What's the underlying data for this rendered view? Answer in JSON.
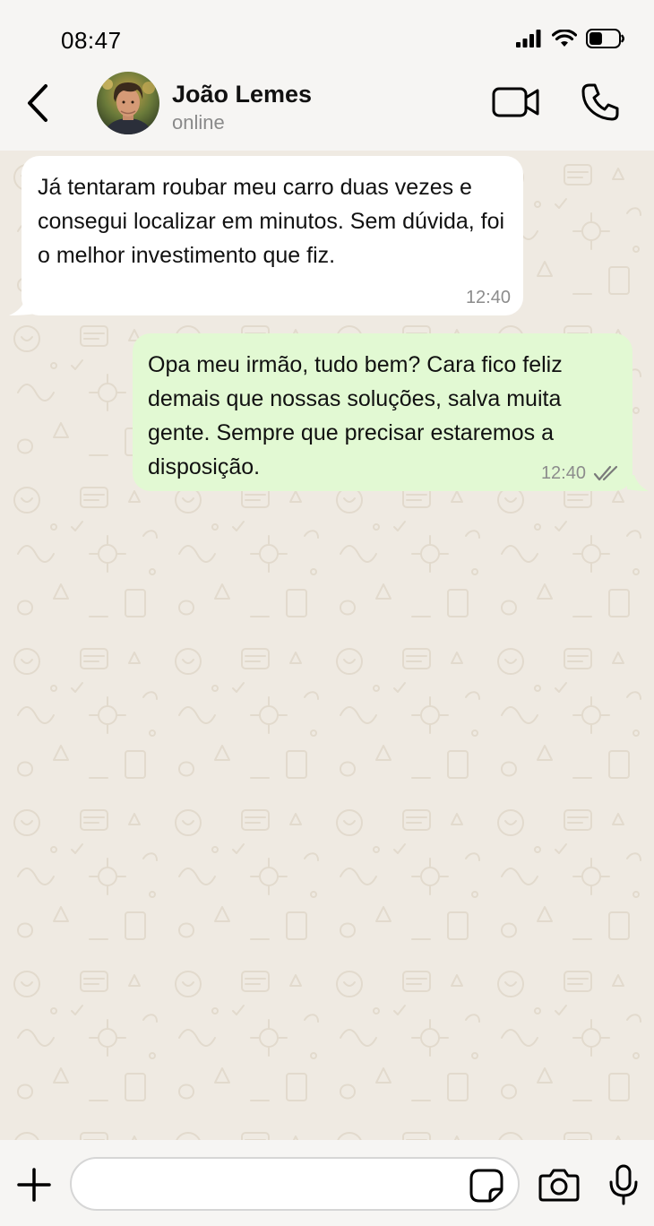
{
  "status_bar": {
    "time": "08:47",
    "icons": [
      "signal-icon",
      "wifi-icon",
      "battery-icon"
    ],
    "battery_level": 0.45
  },
  "header": {
    "back_icon": "chevron-left-icon",
    "contact_name": "João Lemes",
    "contact_status": "online",
    "avatar": "contact-avatar",
    "video_call_icon": "video-camera-icon",
    "voice_call_icon": "phone-icon"
  },
  "messages": [
    {
      "direction": "incoming",
      "text": "Já tentaram roubar meu carro duas vezes e consegui localizar em minutos. Sem dúvida, foi o melhor investimento que fiz.",
      "time": "12:40"
    },
    {
      "direction": "outgoing",
      "text": "Opa meu irmão, tudo bem? Cara fico feliz demais que nossas soluções, salva muita gente. Sempre que precisar estaremos a disposição.",
      "time": "12:40",
      "status_icon": "double-check-icon"
    }
  ],
  "composer": {
    "plus_icon": "plus-icon",
    "input_value": "",
    "input_placeholder": "",
    "sticker_icon": "sticker-icon",
    "camera_icon": "camera-icon",
    "mic_icon": "microphone-icon"
  },
  "colors": {
    "app_background": "#f6f5f3",
    "chat_background": "#efeae2",
    "incoming_bubble": "#ffffff",
    "outgoing_bubble": "#e2f9d3",
    "timestamp": "#8c8c8c",
    "secondary_text": "#8a8a8a"
  }
}
